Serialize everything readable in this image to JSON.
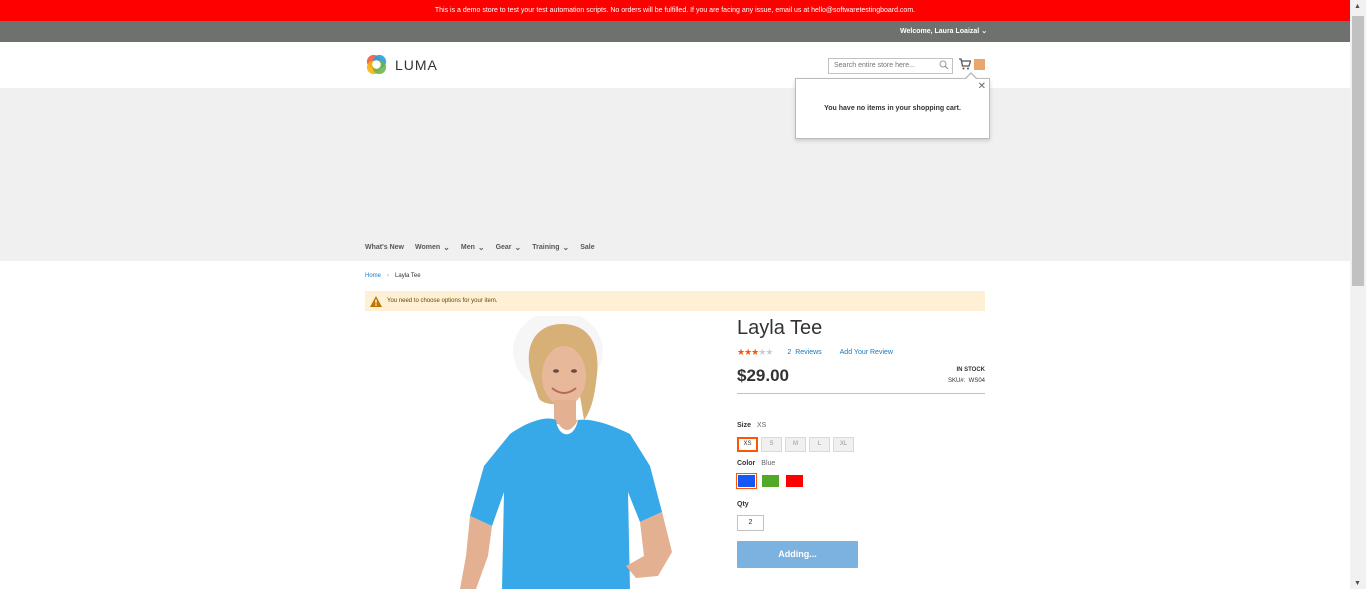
{
  "demo_notice": "This is a demo store to test your test automation scripts. No orders will be fulfilled. If you are facing any issue, email us at hello@softwaretestingboard.com.",
  "header": {
    "welcome": "Welcome, Laura Loaizal",
    "logo_text": "LUMA",
    "search_placeholder": "Search entire store here..."
  },
  "minicart": {
    "empty_message": "You have no items in your shopping cart."
  },
  "nav": {
    "items": [
      {
        "label": "What's New",
        "has_submenu": false
      },
      {
        "label": "Women",
        "has_submenu": true
      },
      {
        "label": "Men",
        "has_submenu": true
      },
      {
        "label": "Gear",
        "has_submenu": true
      },
      {
        "label": "Training",
        "has_submenu": true
      },
      {
        "label": "Sale",
        "has_submenu": false
      }
    ]
  },
  "breadcrumbs": {
    "home": "Home",
    "current": "Layla Tee"
  },
  "message": "You need to choose options for your item.",
  "product": {
    "title": "Layla Tee",
    "rating_stars": 3,
    "rating_max": 5,
    "reviews_count": "2",
    "reviews_label": "Reviews",
    "add_review": "Add Your Review",
    "price": "$29.00",
    "stock": "IN STOCK",
    "sku_label": "SKU#:",
    "sku_value": "WS04",
    "size_label": "Size",
    "size_selected": "XS",
    "sizes": [
      "XS",
      "S",
      "M",
      "L",
      "XL"
    ],
    "color_label": "Color",
    "color_selected": "Blue",
    "colors": [
      {
        "name": "Blue",
        "hex": "#1857f7"
      },
      {
        "name": "Green",
        "hex": "#53a828"
      },
      {
        "name": "Red",
        "hex": "#ff0000"
      }
    ],
    "qty_label": "Qty",
    "qty_value": "2",
    "add_button": "Adding..."
  },
  "colors": {
    "demo_bar": "#ff0000",
    "panel": "#6e716e",
    "link": "#1979c3",
    "accent": "#ff5501",
    "button": "#7bb2e0"
  }
}
